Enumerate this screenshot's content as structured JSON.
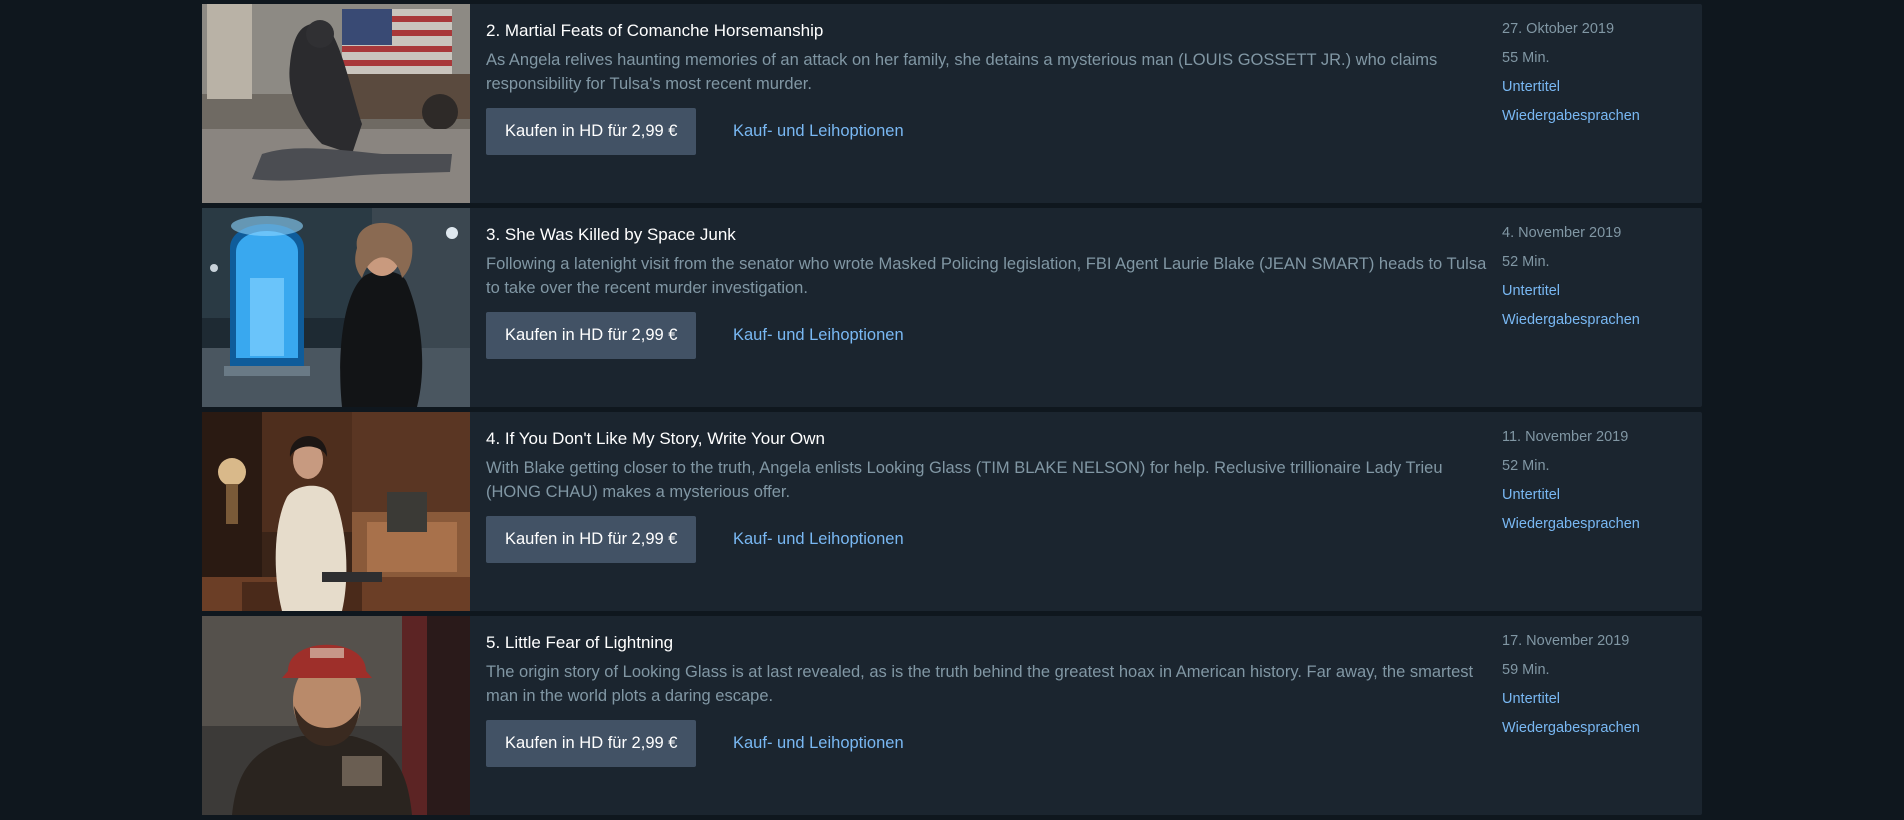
{
  "episodes": [
    {
      "title": "2. Martial Feats of Comanche Horsemanship",
      "synopsis": "As Angela relives haunting memories of an attack on her family, she detains a mysterious man (LOUIS GOSSETT JR.) who claims responsibility for Tulsa's most recent murder.",
      "buy_label": "Kaufen in HD für 2,99 €",
      "options_label": "Kauf- und Leihoptionen",
      "date": "27. Oktober 2019",
      "duration": "55 Min.",
      "subtitles_label": "Untertitel",
      "audio_label": "Wiedergabesprachen"
    },
    {
      "title": "3. She Was Killed by Space Junk",
      "synopsis": "Following a latenight visit from the senator who wrote Masked Policing legislation, FBI Agent Laurie Blake (JEAN SMART) heads to Tulsa to take over the recent murder investigation.",
      "buy_label": "Kaufen in HD für 2,99 €",
      "options_label": "Kauf- und Leihoptionen",
      "date": "4. November 2019",
      "duration": "52 Min.",
      "subtitles_label": "Untertitel",
      "audio_label": "Wiedergabesprachen"
    },
    {
      "title": "4. If You Don't Like My Story, Write Your Own",
      "synopsis": "With Blake getting closer to the truth, Angela enlists Looking Glass (TIM BLAKE NELSON) for help. Reclusive trillionaire Lady Trieu (HONG CHAU) makes a mysterious offer.",
      "buy_label": "Kaufen in HD für 2,99 €",
      "options_label": "Kauf- und Leihoptionen",
      "date": "11. November 2019",
      "duration": "52 Min.",
      "subtitles_label": "Untertitel",
      "audio_label": "Wiedergabesprachen"
    },
    {
      "title": "5. Little Fear of Lightning",
      "synopsis": "The origin story of Looking Glass is at last revealed, as is the truth behind the greatest hoax in American history. Far away, the smartest man in the world plots a daring escape.",
      "buy_label": "Kaufen in HD für 2,99 €",
      "options_label": "Kauf- und Leihoptionen",
      "date": "17. November 2019",
      "duration": "59 Min.",
      "subtitles_label": "Untertitel",
      "audio_label": "Wiedergabesprachen"
    }
  ],
  "colors": {
    "page_background": "#0f171e",
    "card_background": "#1b252f",
    "button_background": "#425265",
    "link": "#79b8f3",
    "muted_text": "#8197a4"
  }
}
